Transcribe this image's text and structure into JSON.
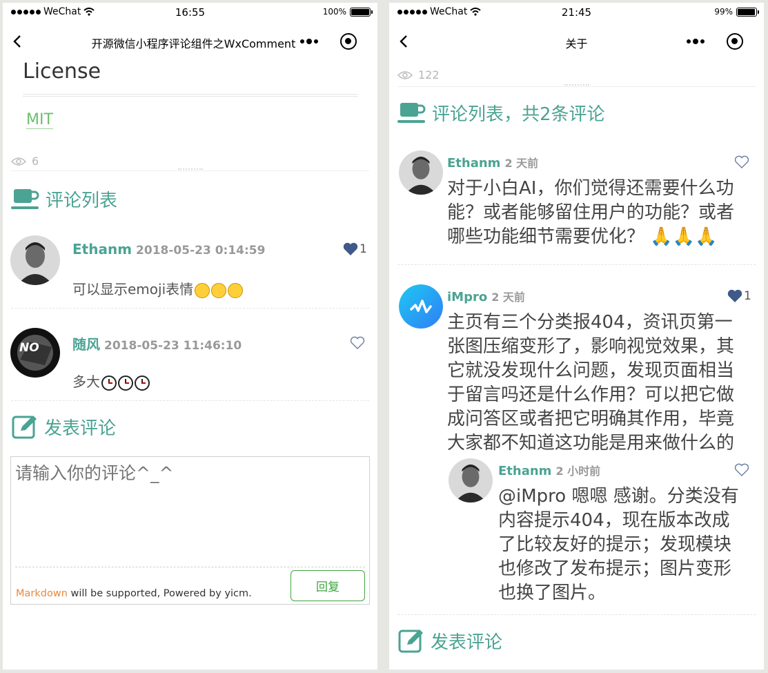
{
  "left": {
    "status": {
      "carrier": "WeChat",
      "time": "16:55",
      "battery": "100%",
      "battery_level": 1.0
    },
    "nav": {
      "title": "开源微信小程序评论组件之WxComment"
    },
    "article": {
      "heading": "License",
      "link": "MIT"
    },
    "views": "6",
    "comments_title": "评论列表",
    "comments": [
      {
        "author": "Ethanm",
        "time": "2018-05-23 0:14:59",
        "text": "可以显示emoji表情",
        "likes": "1",
        "liked": true
      },
      {
        "author": "随风",
        "time": "2018-05-23 11:46:10",
        "text": "多大",
        "likes": "",
        "liked": false
      }
    ],
    "compose": {
      "title": "发表评论",
      "placeholder": "请输入你的评论^_^",
      "markdown": "Markdown",
      "footer_text": " will be supported, Powered by yicm.",
      "reply_button": "回复"
    }
  },
  "right": {
    "status": {
      "carrier": "WeChat",
      "time": "21:45",
      "battery": "99%",
      "battery_level": 0.99
    },
    "nav": {
      "title": "关于"
    },
    "views": "122",
    "comments_title": "评论列表，共2条评论",
    "comments": [
      {
        "author": "Ethanm",
        "time": "2 天前",
        "likes": "",
        "liked": false,
        "lines": [
          "对于小白AI，你们觉得还需要什么功",
          "能？或者能够留住用户的功能？或者",
          "哪些功能细节需要优化？"
        ]
      },
      {
        "author": "iMpro",
        "time": "2 天前",
        "likes": "1",
        "liked": true,
        "lines": [
          "主页有三个分类报404，资讯页第一",
          "张图压缩变形了，影响视觉效果，其",
          "它就没发现什么问题，发现页面相当",
          "于留言吗还是什么作用？可以把它做",
          "成问答区或者把它明确其作用，毕竟",
          "大家都不知道这功能是用来做什么的"
        ],
        "reply": {
          "author": "Ethanm",
          "time": "2 小时前",
          "likes": "",
          "liked": false,
          "lines": [
            "@iMpro 嗯嗯 感谢。分类没有",
            "内容提示404，现在版本改成",
            "了比较友好的提示；发现模块",
            "也修改了发布提示；图片变形",
            "也换了图片。"
          ]
        }
      }
    ],
    "compose": {
      "title": "发表评论"
    }
  },
  "colors": {
    "accent": "#4aa393",
    "heart": "#3f5a8a",
    "markdown": "#e8893d",
    "button": "#3ea43e"
  }
}
